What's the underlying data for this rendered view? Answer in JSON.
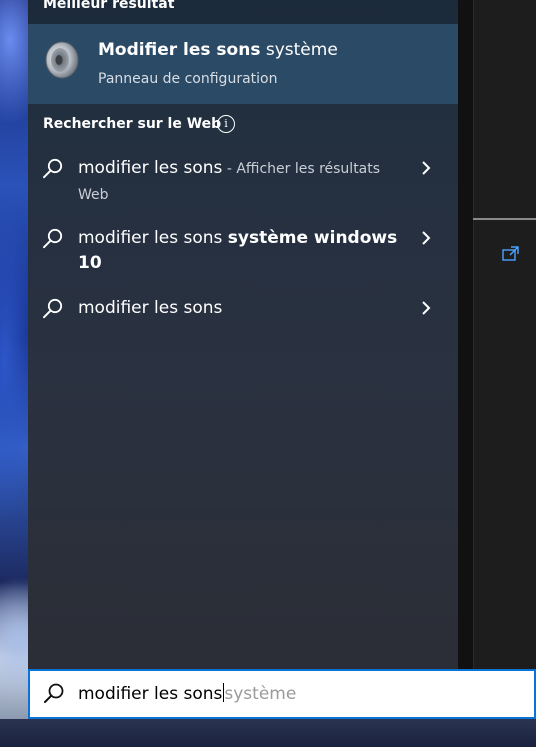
{
  "best_match": {
    "header": "Meilleur résultat",
    "title_bold": "Modifier les sons",
    "title_rest": " système",
    "subtitle": "Panneau de configuration",
    "icon": "speaker-icon"
  },
  "web": {
    "header": "Rechercher sur le Web",
    "info_icon": "i",
    "results": [
      {
        "main": "modifier les sons",
        "suffix": " - Afficher les résultats Web",
        "bold_part": ""
      },
      {
        "main": "modifier les sons ",
        "suffix": "",
        "bold_part": "système windows 10"
      },
      {
        "main": "modifier les sons",
        "suffix": "",
        "bold_part": ""
      }
    ]
  },
  "search": {
    "typed": "modifier les sons",
    "suggestion": "système"
  },
  "colors": {
    "accent": "#0a74d6",
    "selected_row": "#2b4a66",
    "link_icon": "#4aa3ff"
  }
}
